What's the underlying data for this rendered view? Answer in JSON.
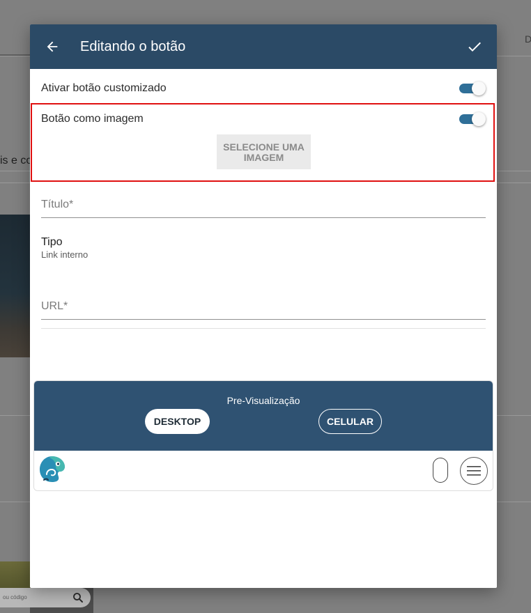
{
  "background": {
    "left_text": "is e co",
    "right_text": "D",
    "search_placeholder": "ou código"
  },
  "modal": {
    "title": "Editando o botão",
    "toggle_custom_label": "Ativar botão customizado",
    "toggle_custom_on": true,
    "toggle_image_label": "Botão como imagem",
    "toggle_image_on": true,
    "select_image_label": "SELECIONE UMA IMAGEM",
    "titulo_placeholder": "Título*",
    "tipo_label": "Tipo",
    "tipo_value": "Link interno",
    "url_placeholder": "URL*"
  },
  "preview": {
    "title": "Pre-Visualização",
    "desktop_label": "DESKTOP",
    "celular_label": "CELULAR"
  },
  "colors": {
    "header": "#2b4a66",
    "preview_header": "#2f5272",
    "toggle": "#2f6f98",
    "highlight": "#e01010"
  },
  "icons": {
    "back": "arrow-left-icon",
    "confirm": "check-icon",
    "menu": "hamburger-menu-icon",
    "logo": "chameleon-logo",
    "search": "search-icon"
  }
}
